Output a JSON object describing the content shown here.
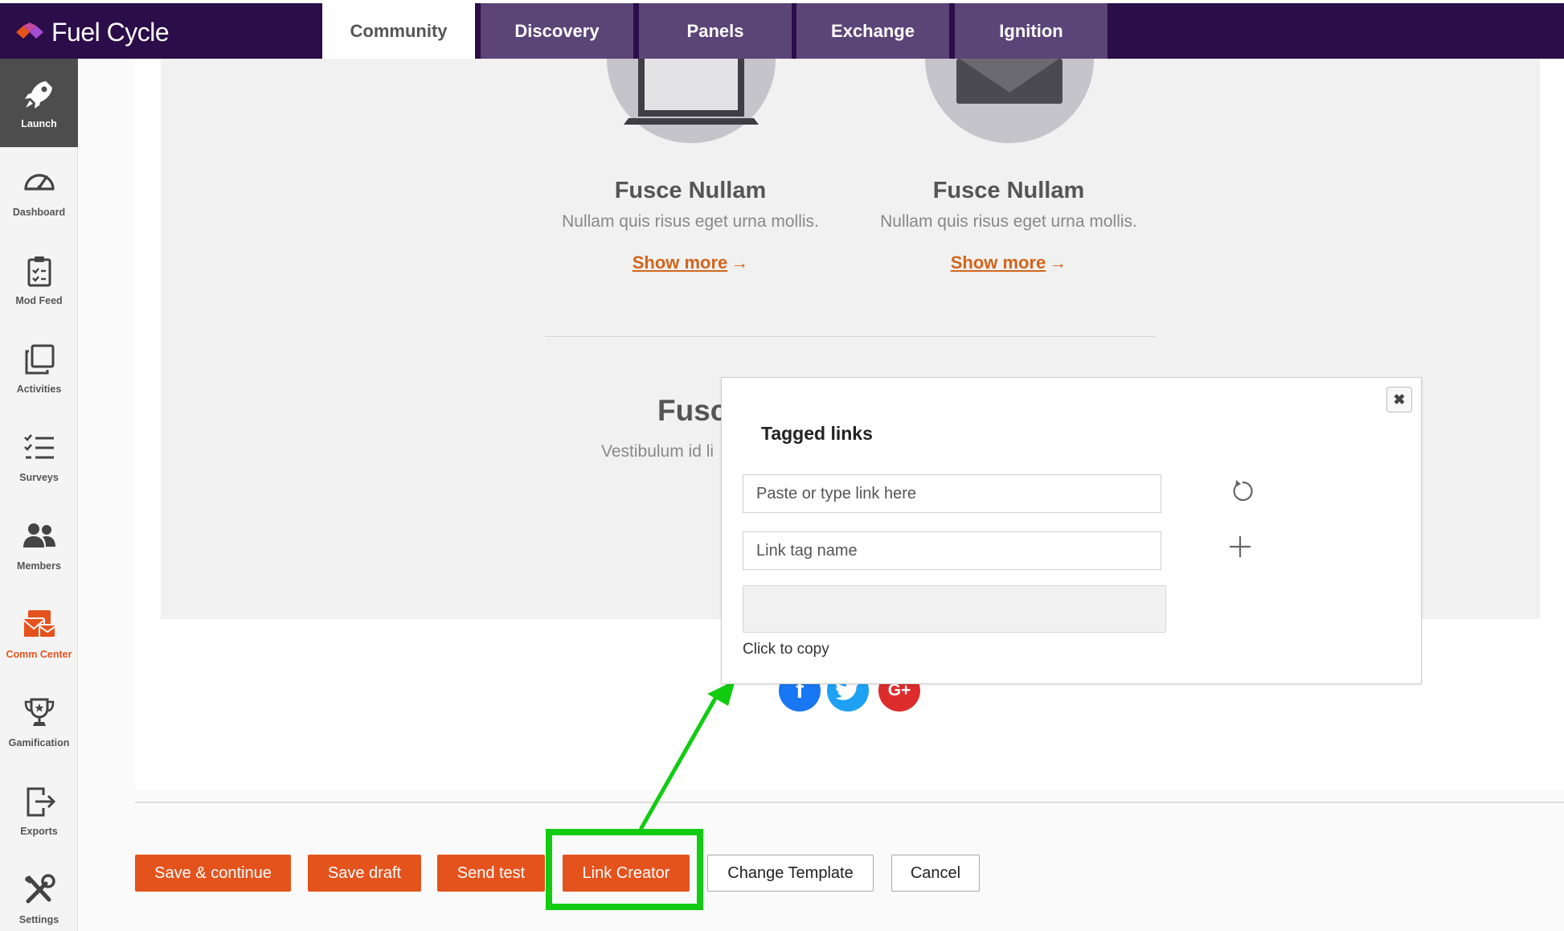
{
  "brand": {
    "name": "Fuel Cycle"
  },
  "tabs": [
    {
      "label": "Community",
      "active": true
    },
    {
      "label": "Discovery"
    },
    {
      "label": "Panels"
    },
    {
      "label": "Exchange"
    },
    {
      "label": "Ignition"
    }
  ],
  "sidebar": {
    "items": [
      {
        "label": "Launch",
        "icon": "rocket-icon"
      },
      {
        "label": "Dashboard",
        "icon": "gauge-icon"
      },
      {
        "label": "Mod Feed",
        "icon": "clipboard-icon"
      },
      {
        "label": "Activities",
        "icon": "stacked-squares-icon"
      },
      {
        "label": "Surveys",
        "icon": "checklist-icon"
      },
      {
        "label": "Members",
        "icon": "users-icon"
      },
      {
        "label": "Comm Center",
        "icon": "mail-stack-icon"
      },
      {
        "label": "Gamification",
        "icon": "trophy-icon"
      },
      {
        "label": "Exports",
        "icon": "export-icon"
      },
      {
        "label": "Settings",
        "icon": "tools-icon"
      }
    ]
  },
  "preview": {
    "cards": [
      {
        "title": "Fusce Nullam",
        "description": "Nullam quis risus eget urna mollis.",
        "link": "Show more",
        "arrow": "→"
      },
      {
        "title": "Fusce Nullam",
        "description": "Nullam quis risus eget urna mollis.",
        "link": "Show more",
        "arrow": "→"
      }
    ],
    "partial_title": "Fusc",
    "partial_description": "Vestibulum id li",
    "social": [
      {
        "icon": "facebook-icon",
        "glyph": "f",
        "color": "#1877f2"
      },
      {
        "icon": "twitter-icon",
        "glyph": "",
        "color": "#1da1f2"
      },
      {
        "icon": "google-plus-icon",
        "glyph": "G+",
        "color": "#dd2c2c"
      }
    ]
  },
  "modal": {
    "title": "Tagged links",
    "close_glyph": "✖",
    "link_placeholder": "Paste or type link here",
    "tag_placeholder": "Link tag name",
    "copy_label": "Click to copy"
  },
  "actions": {
    "save_continue": "Save & continue",
    "save_draft": "Save draft",
    "send_test": "Send test",
    "link_creator": "Link Creator",
    "change_template": "Change Template",
    "cancel": "Cancel"
  },
  "colors": {
    "topbar": "#2b0d49",
    "accent": "#e5531d",
    "link": "#d2651c",
    "highlight": "#12cc12"
  }
}
